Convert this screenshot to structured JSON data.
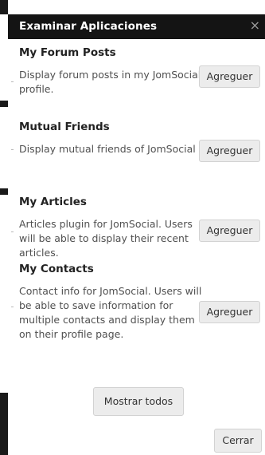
{
  "dialog": {
    "title": "Examinar Aplicaciones",
    "close_glyph": "×",
    "close_icon": "close-icon"
  },
  "apps": [
    {
      "name": "My Forum Posts",
      "description": "Display forum posts in my JomSocial profile.",
      "add_label": "Agreguer"
    },
    {
      "name": "Mutual Friends",
      "description": "Display mutual friends of JomSocial",
      "add_label": "Agreguer"
    },
    {
      "name": "My Articles",
      "description": "Articles plugin for JomSocial. Users will be able to display their recent articles.",
      "add_label": "Agreguer"
    },
    {
      "name": "My Contacts",
      "description": "Contact info for JomSocial. Users will be able to save information for multiple contacts and display them on their profile page.",
      "add_label": "Agreguer"
    }
  ],
  "footer": {
    "show_all_label": "Mostrar todos",
    "close_label": "Cerrar"
  },
  "colors": {
    "titlebar_bg": "#141414",
    "title_text": "#ffffff",
    "button_bg": "#ececec"
  }
}
